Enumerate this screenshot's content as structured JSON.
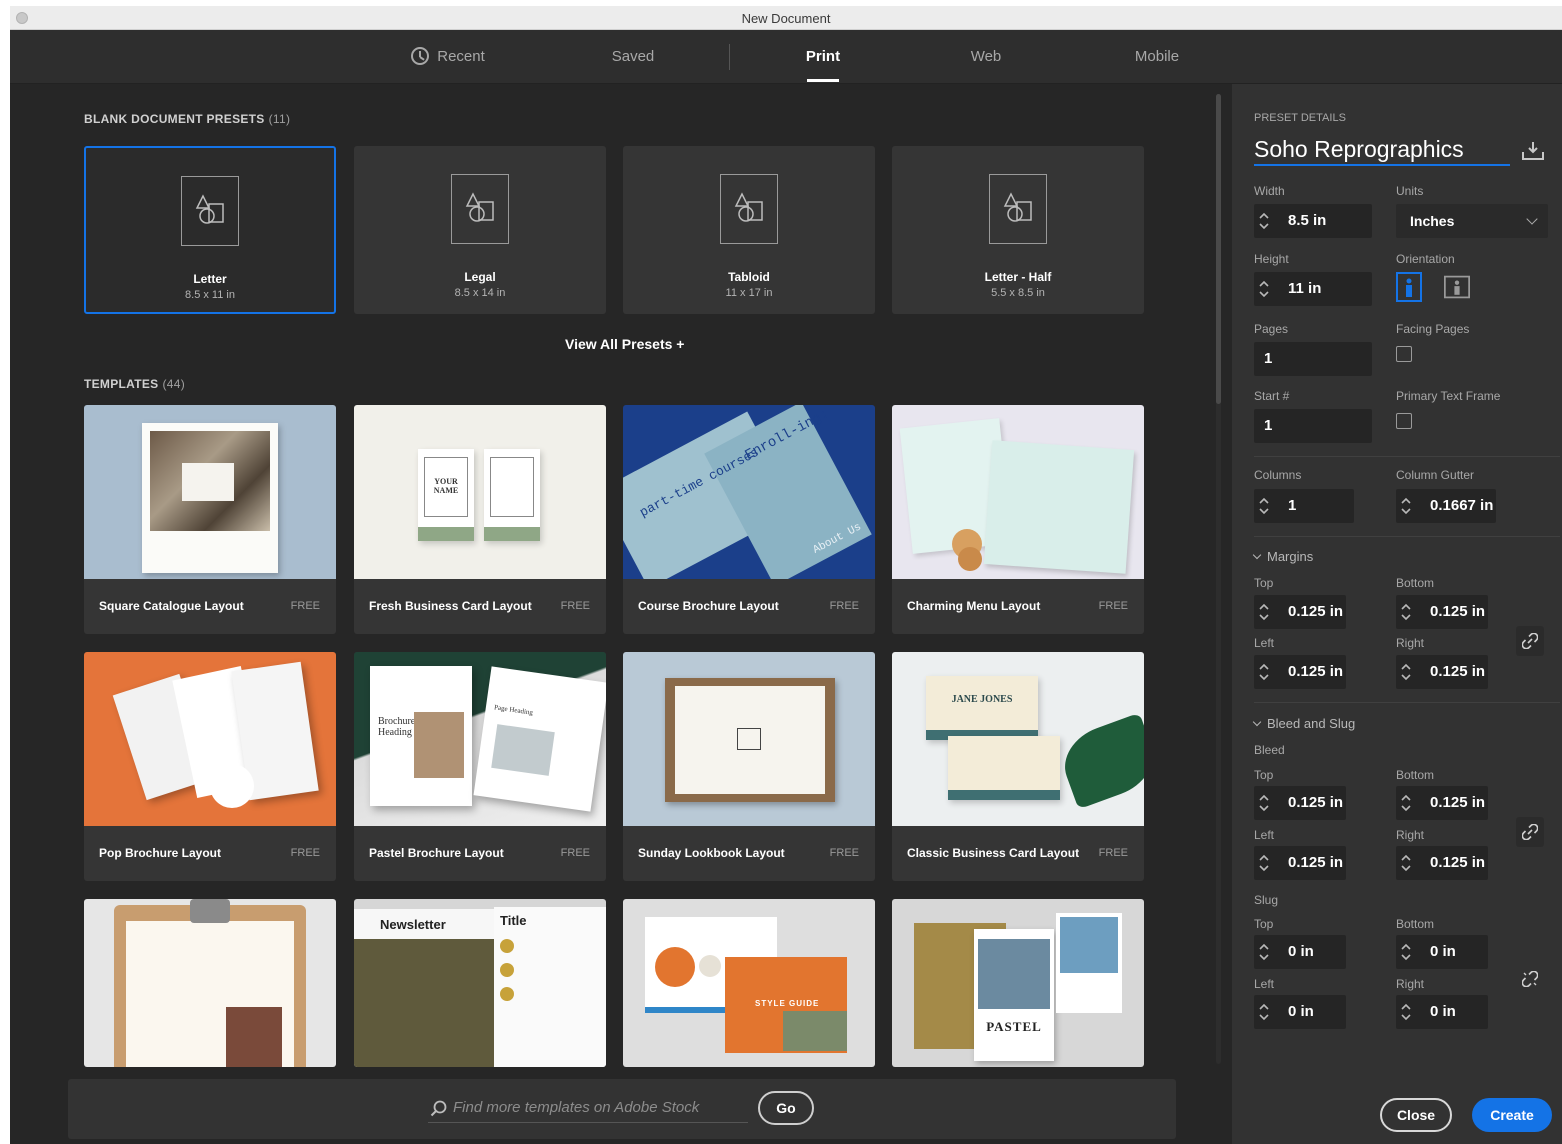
{
  "window": {
    "title": "New Document"
  },
  "tabs": [
    {
      "label": "Recent"
    },
    {
      "label": "Saved"
    },
    {
      "label": "Print"
    },
    {
      "label": "Web"
    },
    {
      "label": "Mobile"
    }
  ],
  "active_tab": "Print",
  "blank_presets": {
    "title": "BLANK DOCUMENT PRESETS",
    "count": "(11)",
    "items": [
      {
        "name": "Letter",
        "size": "8.5 x 11 in"
      },
      {
        "name": "Legal",
        "size": "8.5 x 14 in"
      },
      {
        "name": "Tabloid",
        "size": "11 x 17 in"
      },
      {
        "name": "Letter - Half",
        "size": "5.5 x 8.5 in"
      }
    ],
    "view_all": "View All Presets  +"
  },
  "templates": {
    "title": "TEMPLATES",
    "count": "(44)",
    "free_label": "FREE",
    "items": [
      {
        "name": "Square Catalogue Layout"
      },
      {
        "name": "Fresh Business Card Layout"
      },
      {
        "name": "Course Brochure Layout"
      },
      {
        "name": "Charming Menu Layout"
      },
      {
        "name": "Pop Brochure Layout"
      },
      {
        "name": "Pastel Brochure Layout"
      },
      {
        "name": "Sunday Lookbook Layout"
      },
      {
        "name": "Classic Business Card Layout"
      }
    ],
    "thumb_texts": {
      "your_name": "YOUR NAME",
      "brochure_heading": "Brochure Heading",
      "page_heading": "Page Heading",
      "jane_jones": "JANE JONES",
      "newsletter": "Newsletter",
      "title": "Title",
      "style_guide": "STYLE GUIDE",
      "pastel": "PASTEL",
      "enrolling": "Enroll-ing:",
      "part_time": "part-time courses",
      "about_us": "About Us"
    }
  },
  "search": {
    "placeholder": "Find more templates on Adobe Stock",
    "go_label": "Go"
  },
  "preset_details": {
    "title": "PRESET DETAILS",
    "name": "Soho Reprographics",
    "width_label": "Width",
    "width": "8.5 in",
    "units_label": "Units",
    "units": "Inches",
    "height_label": "Height",
    "height": "11 in",
    "orientation_label": "Orientation",
    "orientation": "portrait",
    "pages_label": "Pages",
    "pages": "1",
    "facing_label": "Facing Pages",
    "start_label": "Start #",
    "start": "1",
    "primary_label": "Primary Text Frame",
    "columns_label": "Columns",
    "columns": "1",
    "gutter_label": "Column Gutter",
    "gutter": "0.1667 in",
    "margins": {
      "label": "Margins",
      "top_label": "Top",
      "top": "0.125 in",
      "bottom_label": "Bottom",
      "bottom": "0.125 in",
      "left_label": "Left",
      "left": "0.125 in",
      "right_label": "Right",
      "right": "0.125 in"
    },
    "bleed_slug": {
      "label": "Bleed and Slug",
      "bleed_label": "Bleed",
      "bleed_top_label": "Top",
      "bleed_top": "0.125 in",
      "bleed_bottom_label": "Bottom",
      "bleed_bottom": "0.125 in",
      "bleed_left_label": "Left",
      "bleed_left": "0.125 in",
      "bleed_right_label": "Right",
      "bleed_right": "0.125 in",
      "slug_label": "Slug",
      "slug_top_label": "Top",
      "slug_top": "0 in",
      "slug_bottom_label": "Bottom",
      "slug_bottom": "0 in",
      "slug_left_label": "Left",
      "slug_left": "0 in",
      "slug_right_label": "Right",
      "slug_right": "0 in"
    }
  },
  "buttons": {
    "close": "Close",
    "create": "Create"
  },
  "colors": {
    "accent": "#1473e6",
    "background": "#262626",
    "panel": "#323232"
  }
}
